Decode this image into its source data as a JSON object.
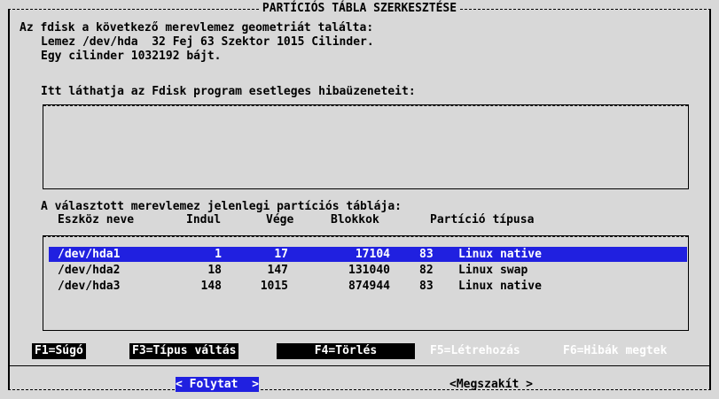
{
  "dialog": {
    "title": "PARTÍCIÓS TÁBLA SZERKESZTÉSE"
  },
  "geometry": {
    "line1": "Az fdisk a következő merevlemez geometriát találta:",
    "line2": "Lemez /dev/hda  32 Fej 63 Szektor 1015 Cilinder.",
    "line3": "Egy cilinder 1032192 bájt."
  },
  "errors": {
    "label": "Itt láthatja az Fdisk program esetleges hibaüzeneteit:",
    "content": ""
  },
  "partitions": {
    "label": "A választott merevlemez jelenlegi partíciós táblája:",
    "headers": {
      "device": "Eszköz neve",
      "start": "Indul",
      "end": "Vége",
      "blocks": "Blokkok",
      "type": "Partíció típusa"
    },
    "rows": [
      {
        "device": "/dev/hda1",
        "start": "1",
        "end": "17",
        "blocks": "17104",
        "id": "83",
        "type": "Linux native",
        "selected": true
      },
      {
        "device": "/dev/hda2",
        "start": "18",
        "end": "147",
        "blocks": "131040",
        "id": "82",
        "type": "Linux swap",
        "selected": false
      },
      {
        "device": "/dev/hda3",
        "start": "148",
        "end": "1015",
        "blocks": "874944",
        "id": "83",
        "type": "Linux native",
        "selected": false
      }
    ]
  },
  "function_keys": {
    "help": "F1=Súgó",
    "change_type": "F3=Típus váltás",
    "delete": "F4=Törlés",
    "create": "F5=Létrehozás",
    "errors": "F6=Hibák megtek"
  },
  "buttons": {
    "continue": "< Folytat  >",
    "cancel": "<Megszakít >"
  },
  "colors": {
    "background": "#d8d8d8",
    "highlight": "#2020e0",
    "text": "#000000",
    "inverse_text": "#ffffff"
  }
}
